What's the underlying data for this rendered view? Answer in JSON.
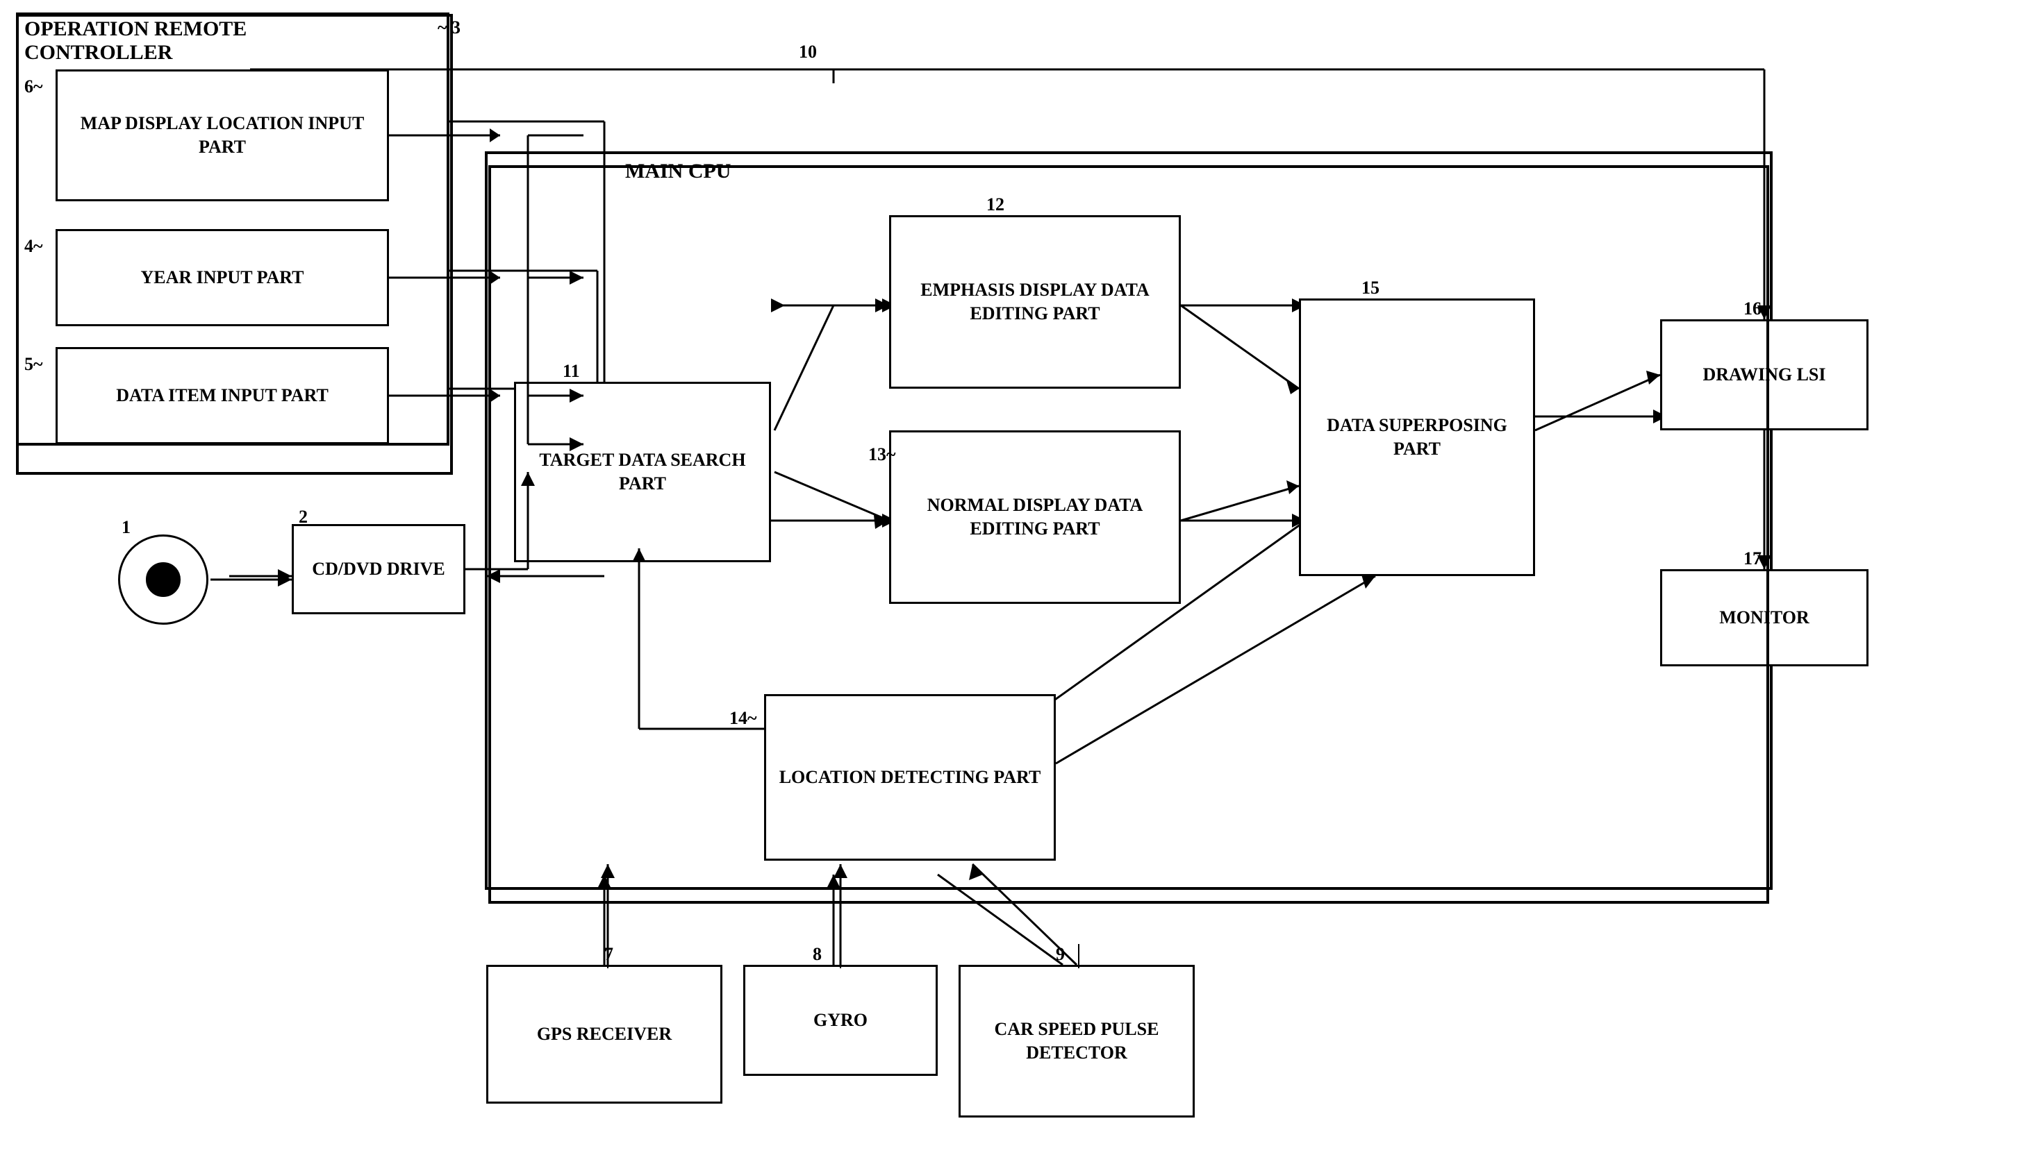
{
  "title": "OPERATION REMOTE CONTROLLER",
  "components": {
    "operation_remote_controller": {
      "label": "OPERATION REMOTE\nCONTROLLER",
      "ref": "3"
    },
    "map_display": {
      "label": "MAP DISPLAY\nLOCATION\nINPUT PART",
      "ref": "6"
    },
    "year_input": {
      "label": "YEAR INPUT\nPART",
      "ref": "4"
    },
    "data_item_input": {
      "label": "DATA ITEM\nINPUT PART",
      "ref": "5"
    },
    "cd_dvd_drive": {
      "label": "CD/DVD\nDRIVE",
      "ref": "2"
    },
    "disc_icon": {
      "ref": "1"
    },
    "main_cpu": {
      "label": "MAIN CPU"
    },
    "target_data_search": {
      "label": "TARGET DATA\nSEARCH PART",
      "ref": "11"
    },
    "emphasis_display": {
      "label": "EMPHASIS\nDISPLAY DATA\nEDITING PART",
      "ref": "12"
    },
    "normal_display": {
      "label": "NORMAL\nDISPLAY DATA\nEDITING PART",
      "ref": "13"
    },
    "location_detecting": {
      "label": "LOCATION\nDETECTING\nPART",
      "ref": "14"
    },
    "data_superposing": {
      "label": "DATA\nSUPERPOSING\nPART",
      "ref": "15"
    },
    "drawing_lsi": {
      "label": "DRAWING LSI",
      "ref": "16"
    },
    "monitor": {
      "label": "MONITOR",
      "ref": "17"
    },
    "gps_receiver": {
      "label": "GPS\nRECEIVER",
      "ref": "7"
    },
    "gyro": {
      "label": "GYRO",
      "ref": "8"
    },
    "car_speed": {
      "label": "CAR SPEED\nPULSE\nDETECTOR",
      "ref": "9"
    },
    "connection_10": {
      "ref": "10"
    }
  }
}
